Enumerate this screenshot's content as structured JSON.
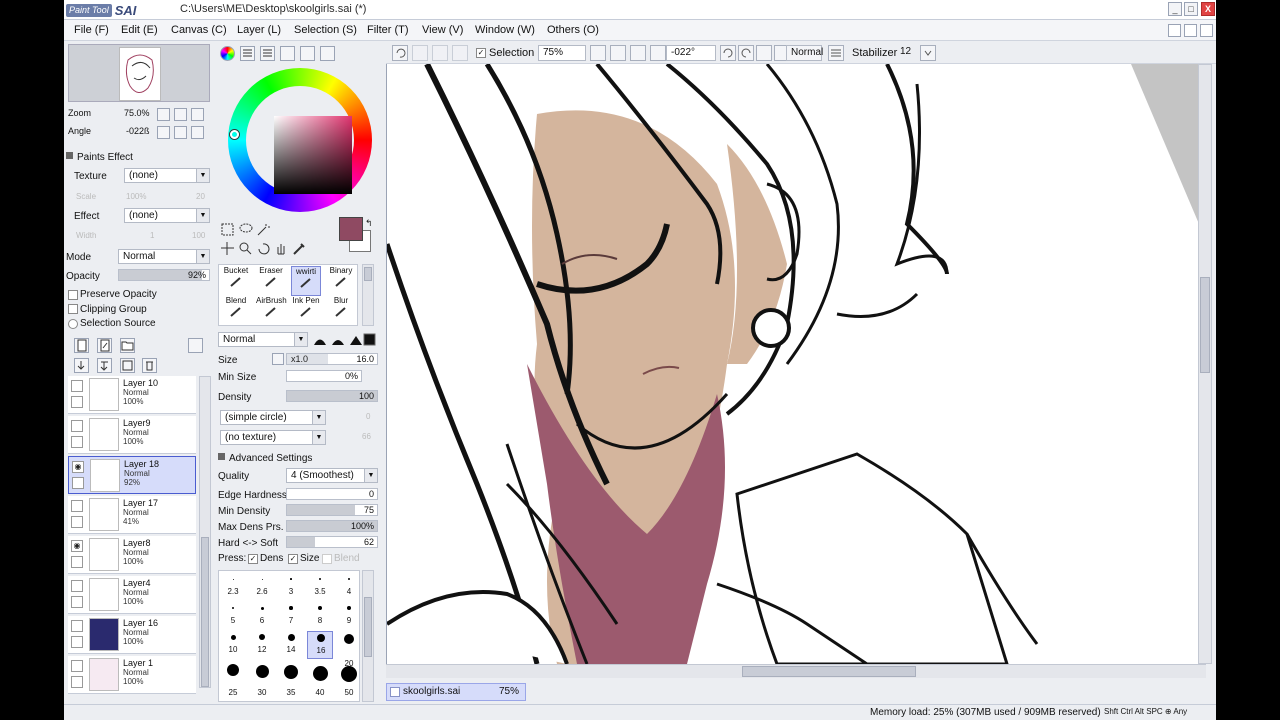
{
  "window": {
    "logo_small": "Paint Tool",
    "logo_big": "SAI",
    "title": "C:\\Users\\ME\\Desktop\\skoolgirls.sai (*)",
    "min_label": "_",
    "max_label": "□",
    "close_label": "X"
  },
  "menu": [
    "File (F)",
    "Edit (E)",
    "Canvas (C)",
    "Layer (L)",
    "Selection (S)",
    "Filter (T)",
    "View (V)",
    "Window (W)",
    "Others (O)"
  ],
  "navigator": {
    "zoom_label": "Zoom",
    "zoom_value": "75.0%",
    "angle_label": "Angle",
    "angle_value": "-022ß"
  },
  "paints_effect": {
    "header": "Paints Effect",
    "texture_label": "Texture",
    "texture_value": "(none)",
    "texture_scale": "100%",
    "texture_scale_label": "Scale",
    "texture_right": "20",
    "effect_label": "Effect",
    "effect_value": "(none)",
    "effect_width_label": "Width",
    "effect_width": "1",
    "effect_right": "100"
  },
  "layer_props": {
    "mode_label": "Mode",
    "mode_value": "Normal",
    "opacity_label": "Opacity",
    "opacity_value": "92%",
    "opacity_fraction": 0.92,
    "preserve_opacity": "Preserve Opacity",
    "clipping_group": "Clipping Group",
    "selection_source": "Selection Source"
  },
  "layers": [
    {
      "name": "Layer 10",
      "mode": "Normal",
      "opacity": "100%",
      "visible": false,
      "selected": false
    },
    {
      "name": "Layer9",
      "mode": "Normal",
      "opacity": "100%",
      "visible": false,
      "selected": false
    },
    {
      "name": "Layer 18",
      "mode": "Normal",
      "opacity": "92%",
      "visible": true,
      "selected": true
    },
    {
      "name": "Layer 17",
      "mode": "Normal",
      "opacity": "41%",
      "visible": false,
      "selected": false
    },
    {
      "name": "Layer8",
      "mode": "Normal",
      "opacity": "100%",
      "visible": true,
      "selected": false
    },
    {
      "name": "Layer4",
      "mode": "Normal",
      "opacity": "100%",
      "visible": false,
      "selected": false
    },
    {
      "name": "Layer 16",
      "mode": "Normal",
      "opacity": "100%",
      "visible": false,
      "selected": false
    },
    {
      "name": "Layer 1",
      "mode": "Normal",
      "opacity": "100%",
      "visible": false,
      "selected": false
    }
  ],
  "colors": {
    "foreground": "#8f4a62",
    "background": "#ffffff",
    "selection_accent": "#d6dcfa"
  },
  "tools": [
    {
      "label": "Bucket",
      "icon": "bucket-icon"
    },
    {
      "label": "Eraser",
      "icon": "eraser-icon"
    },
    {
      "label": "wwirti",
      "icon": "pen-icon",
      "selected": true
    },
    {
      "label": "Binary",
      "icon": "pencil-icon"
    },
    {
      "label": "Blend",
      "icon": "blend-icon"
    },
    {
      "label": "AirBrush",
      "icon": "airbrush-icon"
    },
    {
      "label": "Ink Pen",
      "icon": "ink-pen-icon"
    },
    {
      "label": "Blur",
      "icon": "blur-icon"
    }
  ],
  "brush": {
    "blend_mode": "Normal",
    "size_label": "Size",
    "size_mult": "x1.0",
    "size_value": "16.0",
    "min_size_label": "Min Size",
    "min_size_value": "0%",
    "density_label": "Density",
    "density_value": "100",
    "shape": "(simple circle)",
    "shape_right": "0",
    "texture": "(no texture)",
    "texture_right": "66",
    "advanced_header": "Advanced Settings",
    "quality_label": "Quality",
    "quality_value": "4 (Smoothest)",
    "edge_hardness_label": "Edge Hardness",
    "edge_hardness_value": "0",
    "min_density_label": "Min Density",
    "min_density_value": "75",
    "max_dens_label": "Max Dens Prs.",
    "max_dens_value": "100%",
    "hard_soft_label": "Hard <-> Soft",
    "hard_soft_value": "62",
    "press_label": "Press:",
    "press_dens": "Dens",
    "press_size": "Size",
    "press_blend": "Blend"
  },
  "brush_sizes": [
    "2.3",
    "2.6",
    "3",
    "3.5",
    "4",
    "5",
    "6",
    "7",
    "8",
    "9",
    "10",
    "12",
    "14",
    "16",
    "20",
    "25",
    "30",
    "35",
    "40",
    "50"
  ],
  "canvas_toolbar": {
    "selection_label": "Selection",
    "zoom_value": "75%",
    "angle_value": "-022°",
    "blend_value": "Normal",
    "stabilizer_label": "Stabilizer",
    "stabilizer_value": "12"
  },
  "file_tab": {
    "name": "skoolgirls.sai",
    "zoom": "75%"
  },
  "status": {
    "memory": "Memory load: 25% (307MB used / 909MB reserved)",
    "keys": "Shft Ctrl Alt SPC ⊕ Any"
  }
}
